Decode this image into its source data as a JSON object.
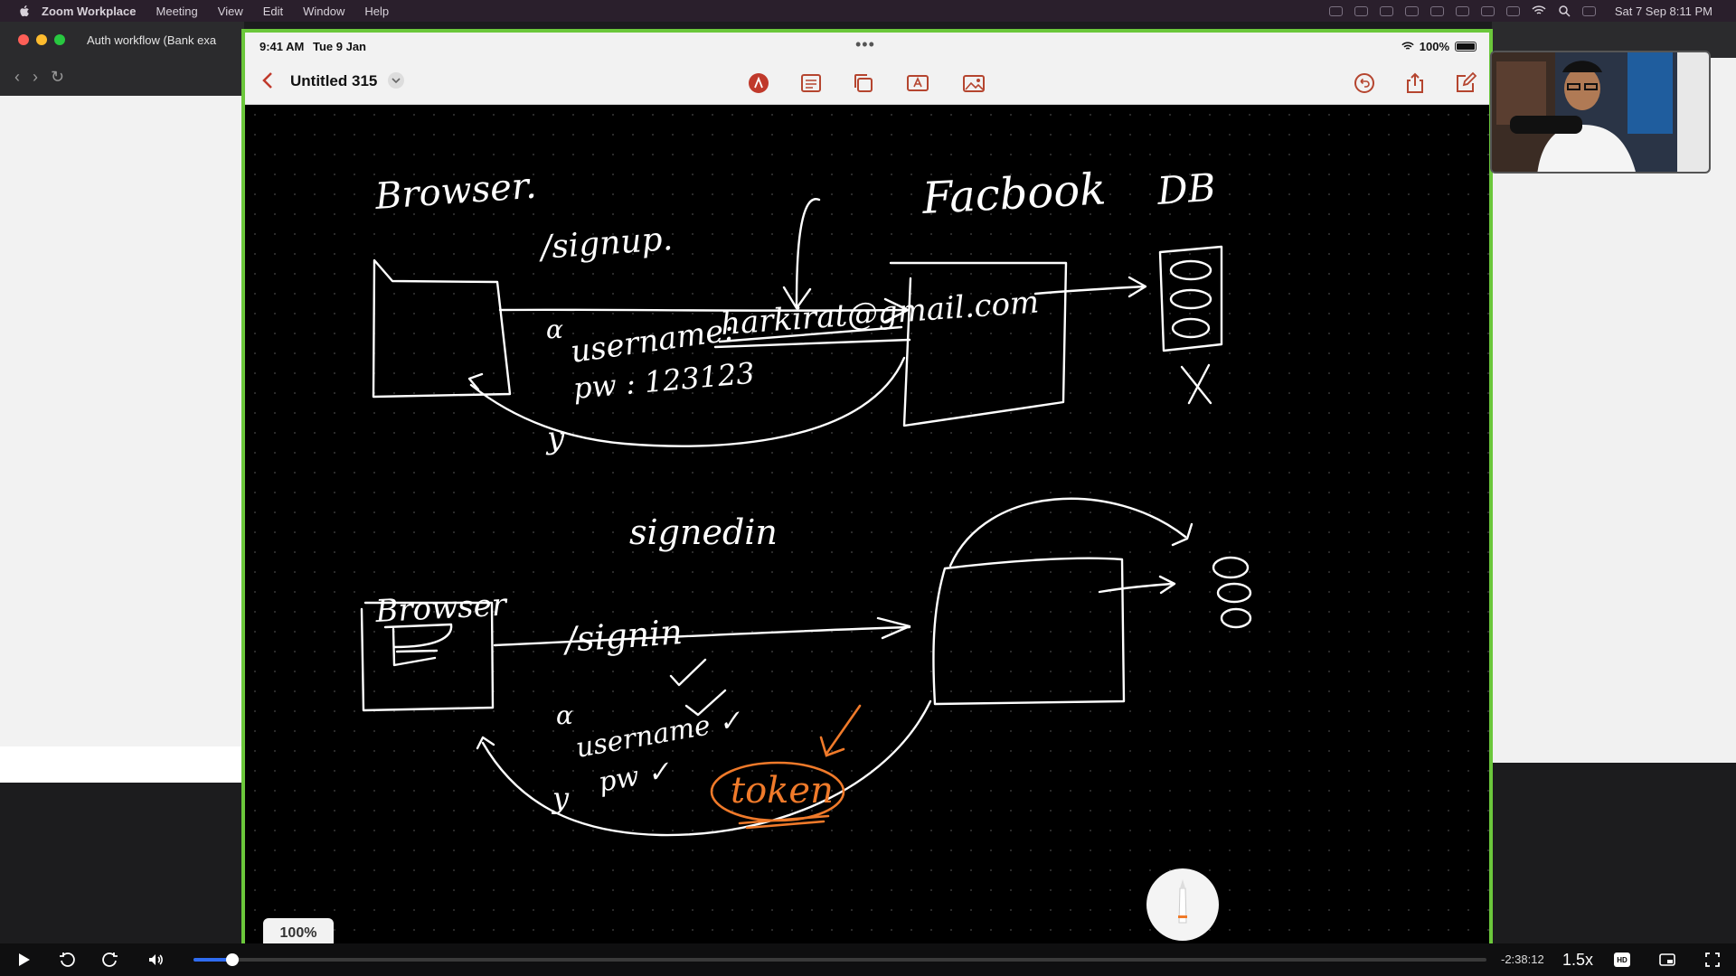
{
  "menubar": {
    "items": [
      "Zoom Workplace",
      "Meeting",
      "View",
      "Edit",
      "Window",
      "Help"
    ],
    "clock": "Sat 7 Sep  8:11 PM"
  },
  "browser": {
    "tab_title": "Auth workflow (Bank exa"
  },
  "ipad": {
    "status_time": "9:41 AM",
    "status_date": "Tue 9 Jan",
    "battery": "100%",
    "doc_title": "Untitled 315",
    "zoom_level": "100%",
    "tools": [
      "markup-icon",
      "notes-icon",
      "shapes-icon",
      "text-icon",
      "image-icon"
    ],
    "right_tools": [
      "undo-icon",
      "share-icon",
      "compose-icon"
    ]
  },
  "whiteboard": {
    "labels": {
      "browser_top": "Browser.",
      "facebook": "Facbook",
      "db": "DB",
      "signup": "/signup.",
      "email": "harkirat@gmail.com",
      "username": "username:",
      "password": "pw  :  123123",
      "signedin": "signedin",
      "browser_bottom": "Browser",
      "signin": "/signin",
      "username_check": "username ✓",
      "pw_check": "pw ✓",
      "token": "token"
    },
    "colors": {
      "ink": "#ffffff",
      "accent": "#f07a2a"
    }
  },
  "player": {
    "time_remaining": "-2:38:12",
    "speed": "1.5x",
    "progress": 0.03
  }
}
